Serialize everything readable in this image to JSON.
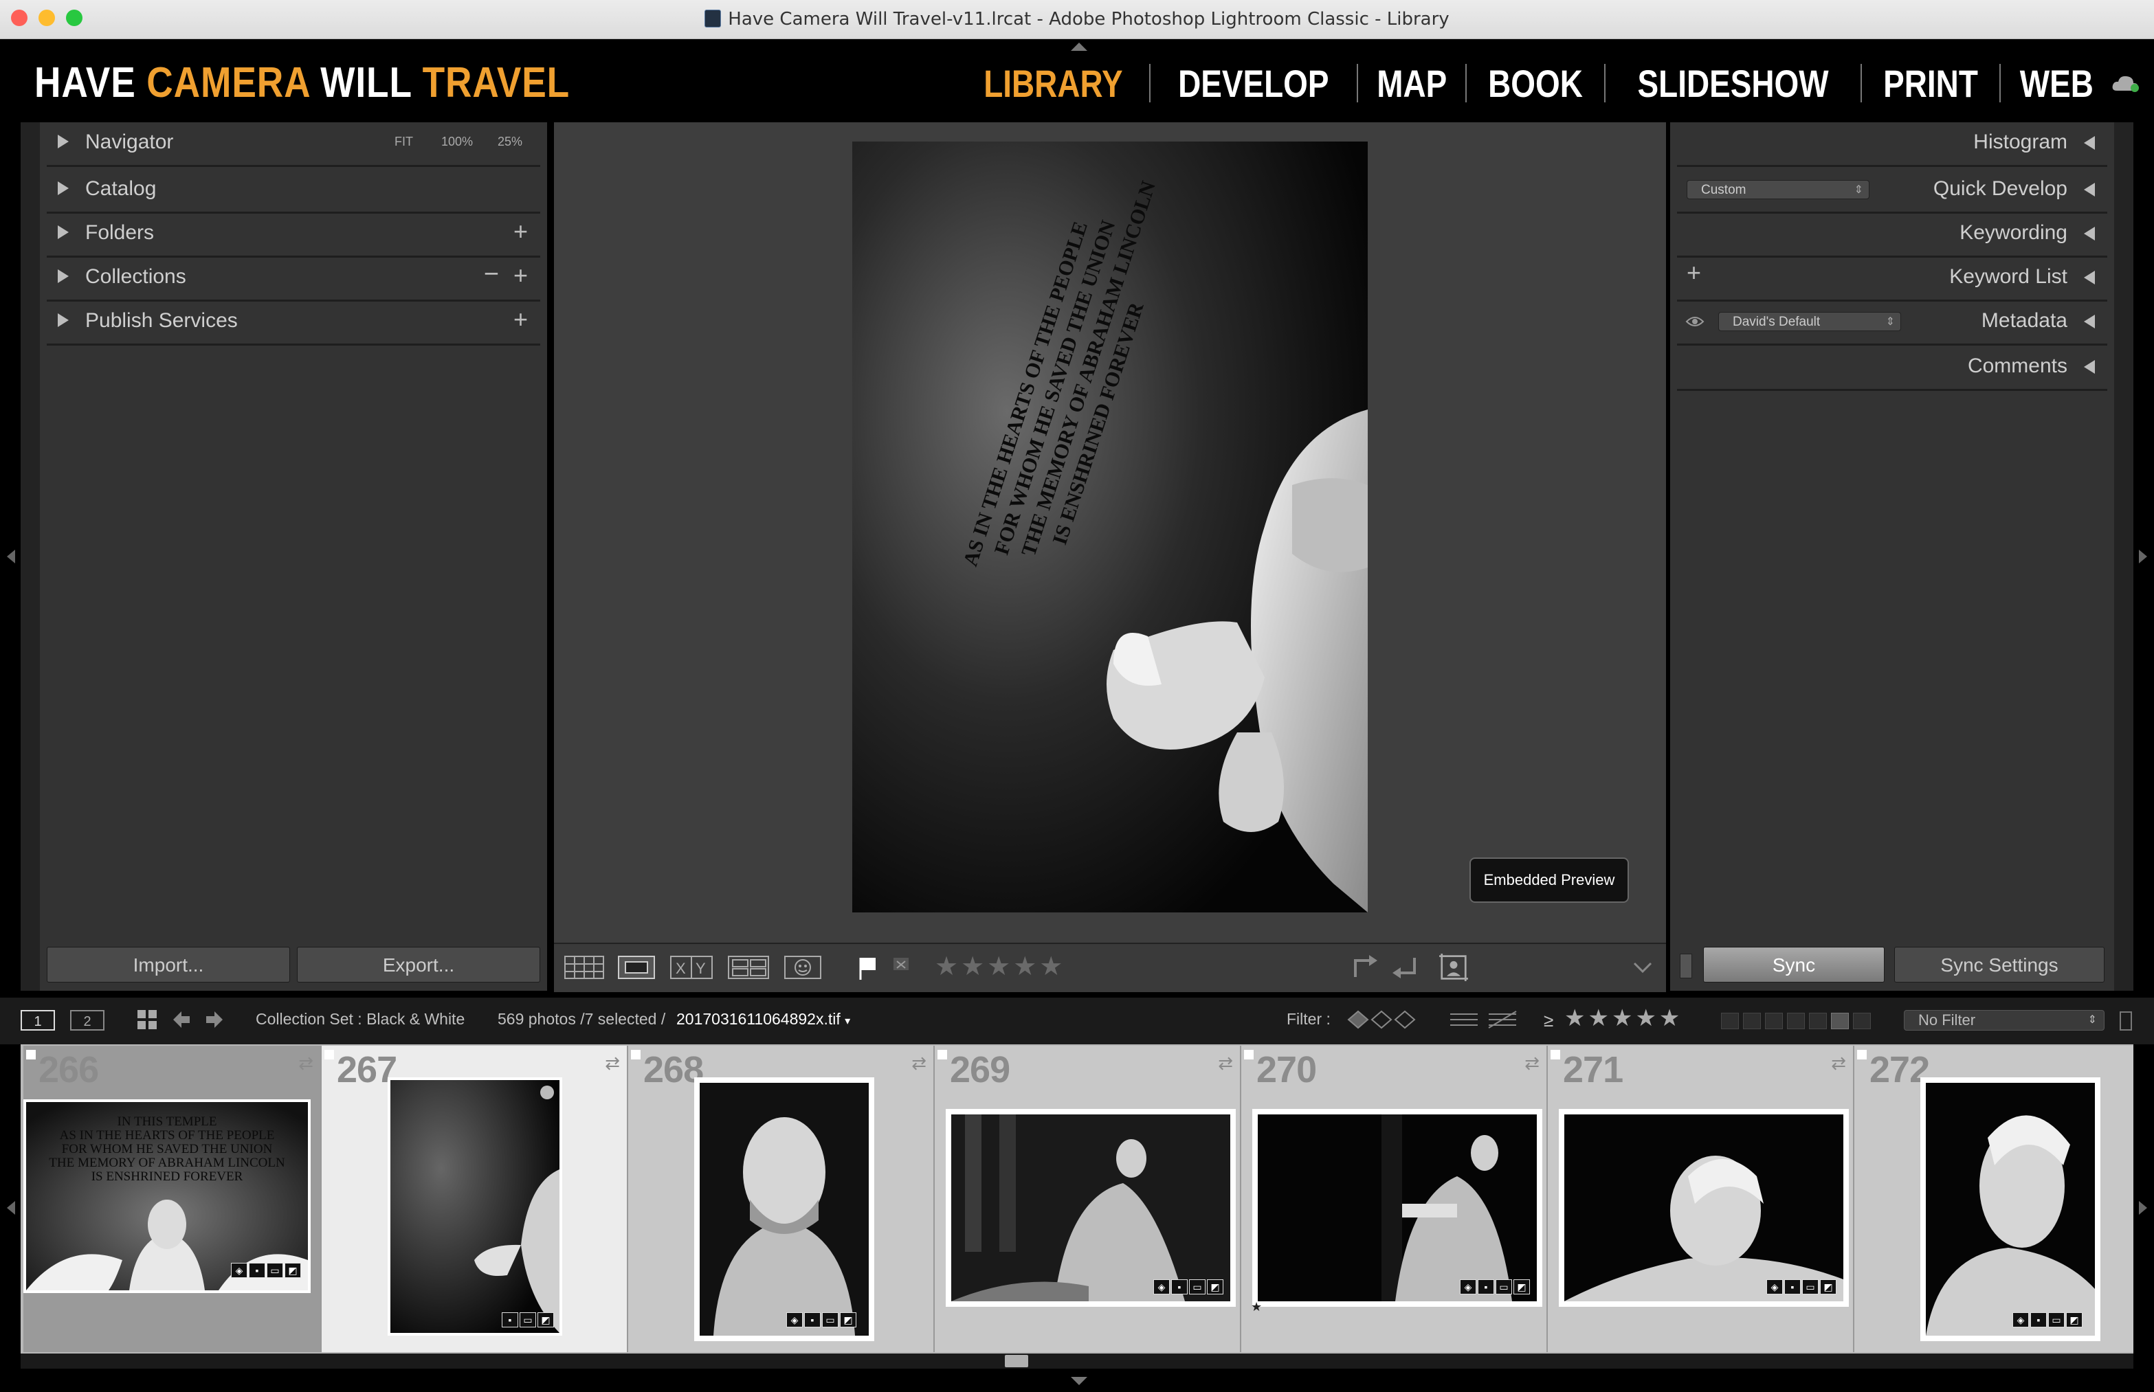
{
  "window": {
    "title": "Have Camera Will Travel-v11.lrcat - Adobe Photoshop Lightroom Classic - Library",
    "app_icon": "Lrc",
    "lights": [
      "#fe5f57",
      "#febc2e",
      "#28c840"
    ]
  },
  "identity": {
    "w1": "HAVE",
    "o1": "CAMERA",
    "w2": "WILL",
    "o2": "TRAVEL"
  },
  "modules": [
    "LIBRARY",
    "DEVELOP",
    "MAP",
    "BOOK",
    "SLIDESHOW",
    "PRINT",
    "WEB"
  ],
  "active_module": "LIBRARY",
  "left_panel": {
    "navigator": {
      "label": "Navigator",
      "fit": "FIT",
      "z100": "100%",
      "z25": "25%"
    },
    "catalog": "Catalog",
    "folders": "Folders",
    "collections": "Collections",
    "publish": "Publish Services",
    "plus": "+",
    "minus": "−",
    "import": "Import...",
    "export": "Export..."
  },
  "right_panel": {
    "histogram": "Histogram",
    "quick_develop": "Quick Develop",
    "quick_develop_preset": "Custom",
    "keywording": "Keywording",
    "keyword_list": "Keyword List",
    "metadata": "Metadata",
    "metadata_preset": "David's Default",
    "comments": "Comments",
    "plus": "+",
    "sync": "Sync",
    "sync_settings": "Sync Settings"
  },
  "center": {
    "embedded_preview": "Embedded Preview",
    "stars": "★★★★★",
    "inscription": [
      "IN THIS TEMPLE",
      "AS IN THE HEARTS OF THE PEOPLE",
      "FOR WHOM HE SAVED THE UNION",
      "THE MEMORY OF ABRAHAM LINCOLN",
      "IS ENSHRINED FOREVER"
    ]
  },
  "filter_bar": {
    "page1": "1",
    "page2": "2",
    "source": "Collection Set : Black & White",
    "count": "569 photos /7 selected /",
    "filename": "2017031611064892x.tif",
    "filter_label": "Filter :",
    "ge": "≥",
    "stars": "★★★★★",
    "no_filter": "No Filter"
  },
  "filmstrip": [
    {
      "num": "266",
      "selected": true
    },
    {
      "num": "267",
      "active": true
    },
    {
      "num": "268"
    },
    {
      "num": "269"
    },
    {
      "num": "270",
      "star": "★"
    },
    {
      "num": "271"
    },
    {
      "num": "272"
    }
  ],
  "filmstrip_inscription": [
    "IN THIS TEMPLE",
    "AS IN THE HEARTS OF THE PEOPLE",
    "FOR WHOM HE SAVED THE UNION",
    "THE MEMORY OF ABRAHAM LINCOLN",
    "IS ENSHRINED FOREVER"
  ]
}
